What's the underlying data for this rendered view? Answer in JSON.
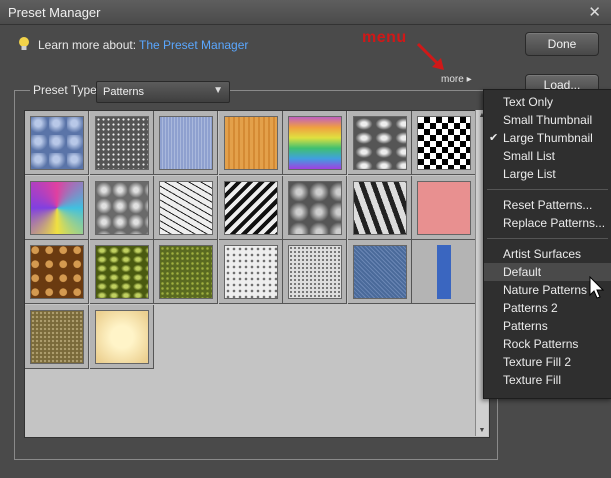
{
  "window": {
    "title": "Preset Manager",
    "close_glyph": "✕"
  },
  "learn": {
    "label": "Learn more about:",
    "link": "The Preset Manager"
  },
  "buttons": {
    "done": "Done",
    "load": "Load..."
  },
  "annotation": "menu",
  "more_label": "more",
  "preset_type": {
    "label": "Preset Type:",
    "value": "Patterns"
  },
  "icons": [
    "lightbulb-icon",
    "close-icon",
    "dropdown-caret-icon",
    "more-arrow-icon",
    "checkmark-icon",
    "mouse-cursor-icon",
    "scroll-up-icon",
    "scroll-down-icon"
  ],
  "patterns": [
    {
      "kind": "bubbles",
      "c": "#6f88b8"
    },
    {
      "kind": "gravel",
      "c": "#8a8a8a"
    },
    {
      "kind": "fabric",
      "c": "#8ea0cf"
    },
    {
      "kind": "wood",
      "c": "#e09840"
    },
    {
      "kind": "rainbow",
      "c": "#b060c0"
    },
    {
      "kind": "marble",
      "c": "#9a9a9a"
    },
    {
      "kind": "checker",
      "c": "#000000"
    },
    {
      "kind": "crystals",
      "c": "#a07ad0"
    },
    {
      "kind": "blobs",
      "c": "#9a9a9a"
    },
    {
      "kind": "cracks",
      "c": "#d8d8d8"
    },
    {
      "kind": "zigzag",
      "c": "#444444"
    },
    {
      "kind": "clouds",
      "c": "#8a8a8a"
    },
    {
      "kind": "zebra",
      "c": "#888888"
    },
    {
      "kind": "pink",
      "c": "#e89090"
    },
    {
      "kind": "giraffe",
      "c": "#8a5a20"
    },
    {
      "kind": "leaves",
      "c": "#8a9a30"
    },
    {
      "kind": "grass",
      "c": "#7a8a30"
    },
    {
      "kind": "stucco",
      "c": "#c8c8c8"
    },
    {
      "kind": "noise",
      "c": "#b0b0b0"
    },
    {
      "kind": "denim",
      "c": "#4a6a9a"
    },
    {
      "kind": "blue-strip",
      "c": "#3a66c0"
    },
    {
      "kind": "sand",
      "c": "#8a7a4a"
    },
    {
      "kind": "parchment",
      "c": "#f0dca0"
    }
  ],
  "menu": {
    "group1": [
      {
        "label": "Text Only",
        "checked": false
      },
      {
        "label": "Small Thumbnail",
        "checked": false
      },
      {
        "label": "Large Thumbnail",
        "checked": true
      },
      {
        "label": "Small List",
        "checked": false
      },
      {
        "label": "Large List",
        "checked": false
      }
    ],
    "group2": [
      "Reset Patterns...",
      "Replace Patterns..."
    ],
    "group3": [
      "Artist Surfaces",
      "Default",
      "Nature Patterns",
      "Patterns 2",
      "Patterns",
      "Rock Patterns",
      "Texture Fill 2",
      "Texture Fill"
    ],
    "highlighted": "Default"
  }
}
